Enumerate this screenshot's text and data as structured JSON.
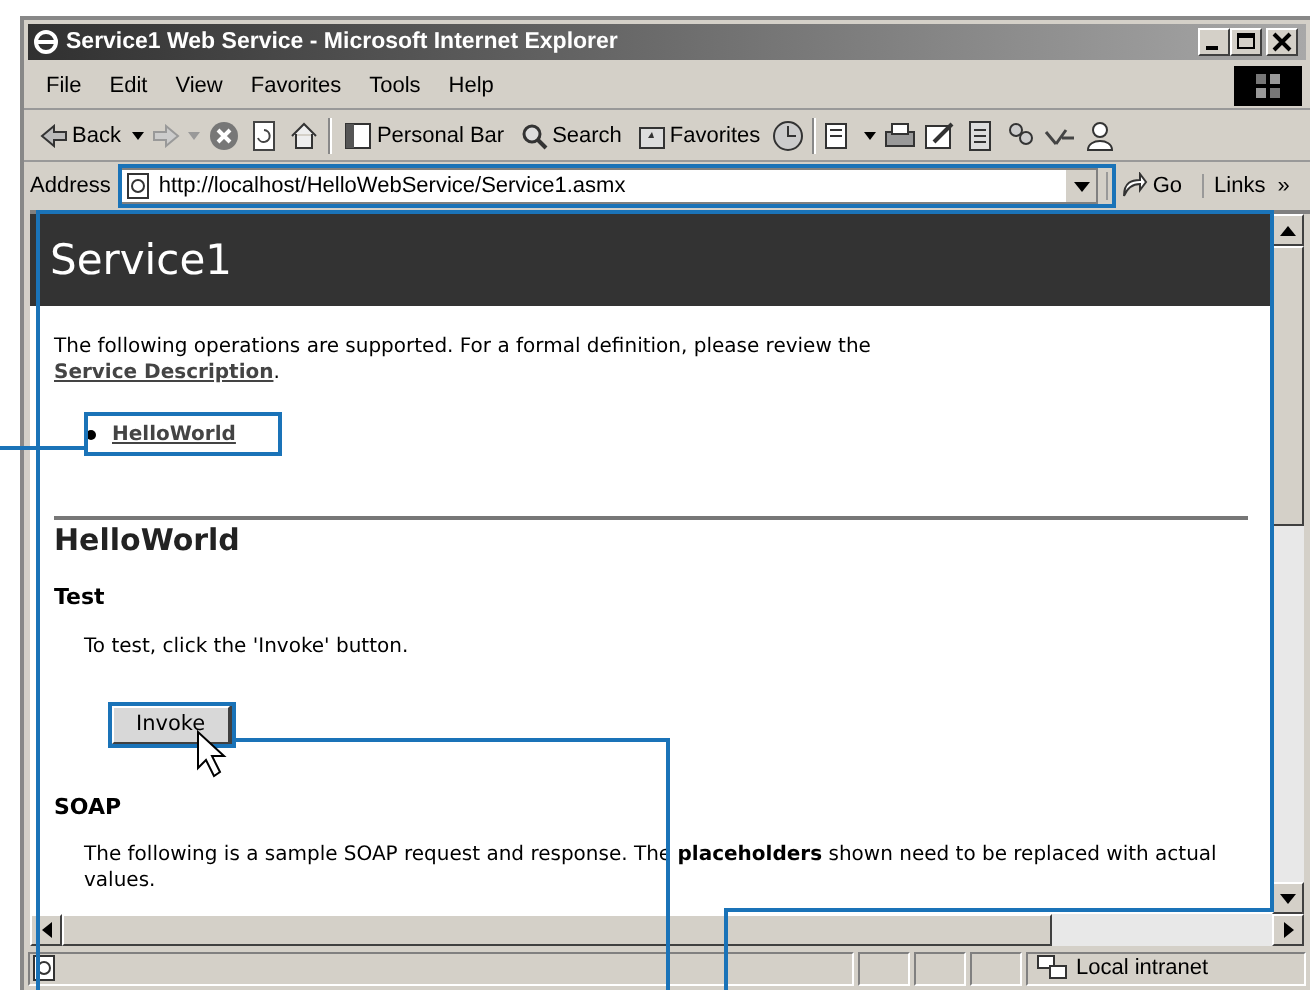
{
  "window": {
    "title": "Service1 Web Service - Microsoft Internet Explorer"
  },
  "menu": [
    "File",
    "Edit",
    "View",
    "Favorites",
    "Tools",
    "Help"
  ],
  "toolbar": {
    "back": "Back",
    "personal_bar": "Personal Bar",
    "search": "Search",
    "favorites": "Favorites"
  },
  "address": {
    "label": "Address",
    "value": "http://localhost/HelloWebService/Service1.asmx",
    "go": "Go",
    "links": "Links",
    "more": "»"
  },
  "page": {
    "heading": "Service1",
    "intro": "The following operations are supported. For a formal definition, please review the",
    "intro_link": "Service Description",
    "intro_end": ".",
    "operations": [
      "HelloWorld"
    ],
    "op_heading": "HelloWorld",
    "test_heading": "Test",
    "test_text": "To test, click the 'Invoke' button.",
    "invoke": "Invoke",
    "soap_heading": "SOAP",
    "soap_text": "The following is a sample SOAP request and response. The **placeholders** shown need to be replaced with actual values."
  },
  "status_bar": {
    "zone": "Local intranet"
  }
}
